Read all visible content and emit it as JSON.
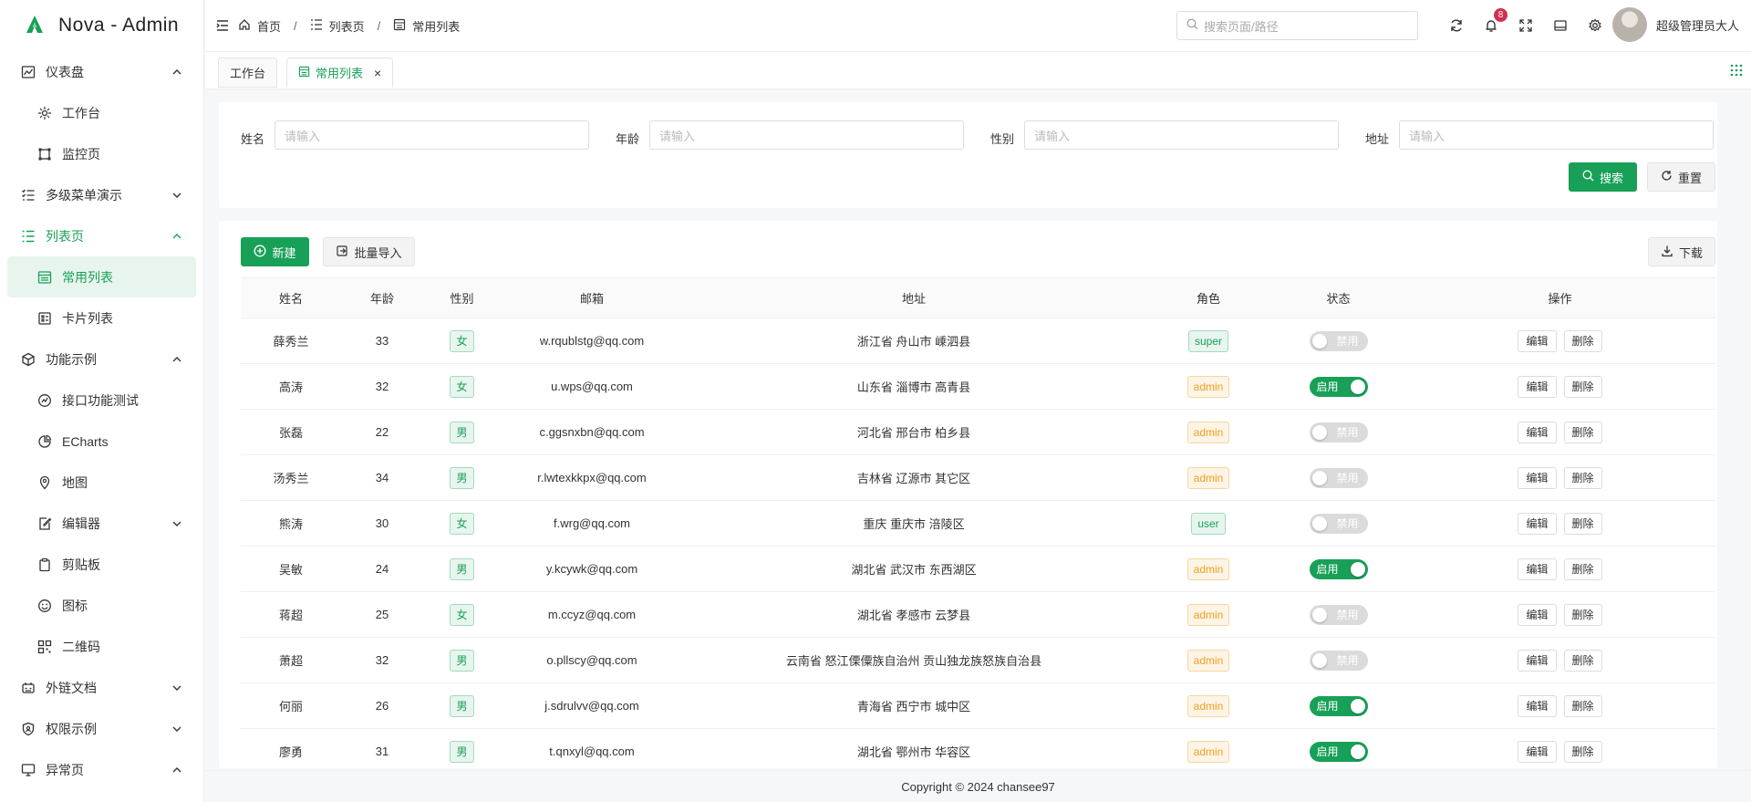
{
  "app": {
    "title": "Nova - Admin",
    "accent": "#18a058"
  },
  "sidebar": {
    "items": [
      {
        "name": "dashboard",
        "label": "仪表盘",
        "icon": "chart-icon",
        "level": 0,
        "arrow": "up"
      },
      {
        "name": "workbench",
        "label": "工作台",
        "icon": "workbench-icon",
        "level": 1
      },
      {
        "name": "monitor",
        "label": "监控页",
        "icon": "monitor-icon",
        "level": 1
      },
      {
        "name": "multimenu",
        "label": "多级菜单演示",
        "icon": "list-check-icon",
        "level": 0,
        "arrow": "down"
      },
      {
        "name": "listpage",
        "label": "列表页",
        "icon": "list-icon",
        "level": 0,
        "arrow": "up",
        "activeParent": true
      },
      {
        "name": "common-list",
        "label": "常用列表",
        "icon": "table-list-icon",
        "level": 1,
        "active": true
      },
      {
        "name": "card-list",
        "label": "卡片列表",
        "icon": "card-list-icon",
        "level": 1
      },
      {
        "name": "features",
        "label": "功能示例",
        "icon": "cube-icon",
        "level": 0,
        "arrow": "up"
      },
      {
        "name": "api-test",
        "label": "接口功能测试",
        "icon": "api-icon",
        "level": 1
      },
      {
        "name": "echarts",
        "label": "ECharts",
        "icon": "pie-icon",
        "level": 1
      },
      {
        "name": "map",
        "label": "地图",
        "icon": "map-icon",
        "level": 1
      },
      {
        "name": "editor",
        "label": "编辑器",
        "icon": "edit-icon",
        "level": 1,
        "arrow": "down"
      },
      {
        "name": "clipboard",
        "label": "剪贴板",
        "icon": "clipboard-icon",
        "level": 1
      },
      {
        "name": "icons",
        "label": "图标",
        "icon": "smile-icon",
        "level": 1
      },
      {
        "name": "qrcode",
        "label": "二维码",
        "icon": "qrcode-icon",
        "level": 1
      },
      {
        "name": "external-docs",
        "label": "外链文档",
        "icon": "docs-icon",
        "level": 0,
        "arrow": "down"
      },
      {
        "name": "permission",
        "label": "权限示例",
        "icon": "shield-icon",
        "level": 0,
        "arrow": "down"
      },
      {
        "name": "exception",
        "label": "异常页",
        "icon": "desktop-icon",
        "level": 0,
        "arrow": "up"
      }
    ]
  },
  "header": {
    "breadcrumb": [
      "首页",
      "列表页",
      "常用列表"
    ],
    "search_placeholder": "搜索页面/路径",
    "notification_count": "8",
    "username": "超级管理员大人"
  },
  "tabs": [
    {
      "label": "工作台"
    },
    {
      "label": "常用列表",
      "active": true
    }
  ],
  "filter": {
    "fields": [
      {
        "label": "姓名",
        "placeholder": "请输入"
      },
      {
        "label": "年龄",
        "placeholder": "请输入"
      },
      {
        "label": "性别",
        "placeholder": "请输入"
      },
      {
        "label": "地址",
        "placeholder": "请输入"
      }
    ],
    "search_label": "搜索",
    "reset_label": "重置"
  },
  "toolbar": {
    "new_label": "新建",
    "import_label": "批量导入",
    "download_label": "下载"
  },
  "table": {
    "columns": [
      "姓名",
      "年龄",
      "性别",
      "邮箱",
      "地址",
      "角色",
      "状态",
      "操作"
    ],
    "edit_label": "编辑",
    "delete_label": "删除",
    "on_label": "启用",
    "off_label": "禁用",
    "rows": [
      {
        "name": "薛秀兰",
        "age": "33",
        "gender": "女",
        "email": "w.rqublstg@qq.com",
        "address": "浙江省 舟山市 嵊泗县",
        "role": "super",
        "enabled": false
      },
      {
        "name": "高涛",
        "age": "32",
        "gender": "女",
        "email": "u.wps@qq.com",
        "address": "山东省 淄博市 高青县",
        "role": "admin",
        "enabled": true
      },
      {
        "name": "张磊",
        "age": "22",
        "gender": "男",
        "email": "c.ggsnxbn@qq.com",
        "address": "河北省 邢台市 柏乡县",
        "role": "admin",
        "enabled": false
      },
      {
        "name": "汤秀兰",
        "age": "34",
        "gender": "男",
        "email": "r.lwtexkkpx@qq.com",
        "address": "吉林省 辽源市 其它区",
        "role": "admin",
        "enabled": false
      },
      {
        "name": "熊涛",
        "age": "30",
        "gender": "女",
        "email": "f.wrg@qq.com",
        "address": "重庆 重庆市 涪陵区",
        "role": "user",
        "enabled": false
      },
      {
        "name": "吴敏",
        "age": "24",
        "gender": "男",
        "email": "y.kcywk@qq.com",
        "address": "湖北省 武汉市 东西湖区",
        "role": "admin",
        "enabled": true
      },
      {
        "name": "蒋超",
        "age": "25",
        "gender": "女",
        "email": "m.ccyz@qq.com",
        "address": "湖北省 孝感市 云梦县",
        "role": "admin",
        "enabled": false
      },
      {
        "name": "萧超",
        "age": "32",
        "gender": "男",
        "email": "o.pllscy@qq.com",
        "address": "云南省 怒江傈僳族自治州 贡山独龙族怒族自治县",
        "role": "admin",
        "enabled": false
      },
      {
        "name": "何丽",
        "age": "26",
        "gender": "男",
        "email": "j.sdrulvv@qq.com",
        "address": "青海省 西宁市 城中区",
        "role": "admin",
        "enabled": true
      },
      {
        "name": "廖勇",
        "age": "31",
        "gender": "男",
        "email": "t.qnxyl@qq.com",
        "address": "湖北省 鄂州市 华容区",
        "role": "admin",
        "enabled": true
      }
    ]
  },
  "footer": {
    "text": "Copyright © 2024 chansee97"
  }
}
